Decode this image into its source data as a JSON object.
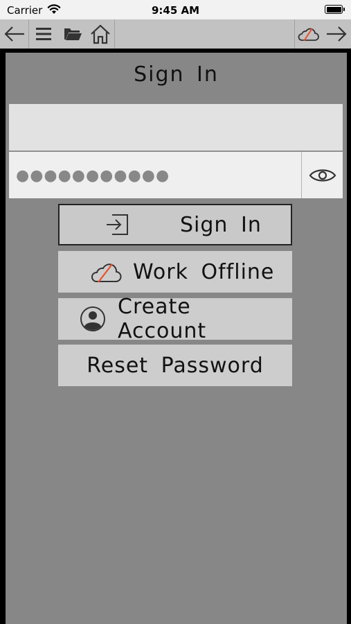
{
  "status_bar": {
    "carrier": "Carrier",
    "time": "9:45 AM"
  },
  "toolbar": {
    "left_icons": [
      "arrow-left-icon",
      "menu-icon",
      "folder-icon",
      "home-icon"
    ],
    "right_icons": [
      "cloud-offline-icon",
      "arrow-right-icon"
    ]
  },
  "signin": {
    "title": "Sign In",
    "username_value": "",
    "password_mask": "●●●●●●●●●●●",
    "buttons": {
      "sign_in": "Sign In",
      "work_offline": "Work Offline",
      "create_account": "Create Account",
      "reset_password": "Reset Password"
    }
  },
  "colors": {
    "panel_bg": "#878787",
    "toolbar_bg": "#c2c2c2",
    "button_bg": "#cdcdcd",
    "offline_slash": "#e8502a"
  }
}
